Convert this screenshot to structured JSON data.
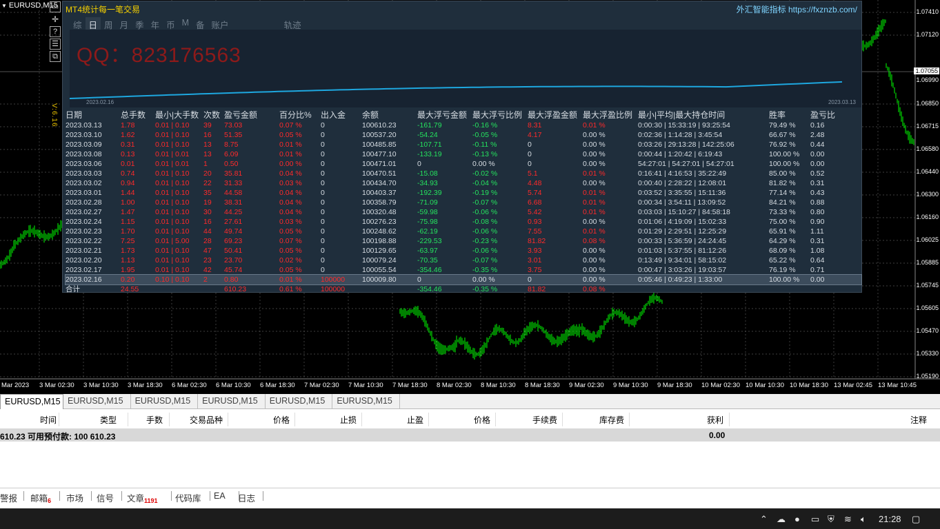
{
  "chart": {
    "symbol": "EURUSD,M15",
    "version_label": "V:6.16",
    "price_ticks": [
      "1.07410",
      "1.07120",
      "1.07055",
      "1.06990",
      "1.06850",
      "1.06715",
      "1.06580",
      "1.06440",
      "1.06300",
      "1.06160",
      "1.06025",
      "1.05885",
      "1.05745",
      "1.05605",
      "1.05470",
      "1.05330",
      "1.05190"
    ],
    "current_price": "1.07055",
    "time_ticks": [
      "Mar 2023",
      "3 Mar 02:30",
      "3 Mar 10:30",
      "3 Mar 18:30",
      "6 Mar 02:30",
      "6 Mar 10:30",
      "6 Mar 18:30",
      "7 Mar 02:30",
      "7 Mar 10:30",
      "7 Mar 18:30",
      "8 Mar 02:30",
      "8 Mar 10:30",
      "8 Mar 18:30",
      "9 Mar 02:30",
      "9 Mar 10:30",
      "9 Mar 18:30",
      "10 Mar 02:30",
      "10 Mar 10:30",
      "10 Mar 18:30",
      "13 Mar 02:45",
      "13 Mar 10:45"
    ],
    "candle_color": "#00ff00"
  },
  "left_icons": [
    "crosshair-icon",
    "help-icon",
    "indicator-list-icon",
    "templates-icon"
  ],
  "panel": {
    "title": "MT4统计每一笔交易",
    "brand": "外汇智能指标 https://fxznzb.com/",
    "tabs": [
      "综",
      "日",
      "周",
      "月",
      "季",
      "年",
      "币",
      "M",
      "备",
      "账户",
      "轨迹"
    ],
    "active_tab": "日",
    "watermark": "QQ：823176563",
    "curve_start": "2023.02.16",
    "curve_end": "2023.03.13",
    "curve_color": "#1ea8e0",
    "headers": [
      "日期",
      "总手数",
      "最小|大手数",
      "次数",
      "盈亏金额",
      "百分比%",
      "出入金",
      "余额",
      "最大浮亏金额",
      "最大浮亏比例",
      "最大浮盈金额",
      "最大浮盈比例",
      "最小|平均|最大持仓时间",
      "胜率",
      "盈亏比"
    ],
    "rows": [
      [
        "2023.03.13",
        "1.78",
        "0.01 | 0.10",
        "39",
        "73.03",
        "0.07 %",
        "0",
        "100610.23",
        "-161.79",
        "-0.16 %",
        "8.31",
        "0.01 %",
        "0:00:30 | 15:33:19 | 93:25:54",
        "79.49 %",
        "0.16"
      ],
      [
        "2023.03.10",
        "1.62",
        "0.01 | 0.10",
        "16",
        "51.35",
        "0.05 %",
        "0",
        "100537.20",
        "-54.24",
        "-0.05 %",
        "4.17",
        "0.00 %",
        "0:02:36 | 1:14:28 | 3:45:54",
        "66.67 %",
        "2.48"
      ],
      [
        "2023.03.09",
        "0.31",
        "0.01 | 0.10",
        "13",
        "8.75",
        "0.01 %",
        "0",
        "100485.85",
        "-107.71",
        "-0.11 %",
        "0",
        "0.00 %",
        "0:03:26 | 29:13:28 | 142:25:06",
        "76.92 %",
        "0.44"
      ],
      [
        "2023.03.08",
        "0.13",
        "0.01 | 0.01",
        "13",
        "6.09",
        "0.01 %",
        "0",
        "100477.10",
        "-133.19",
        "-0.13 %",
        "0",
        "0.00 %",
        "0:00:44 | 1:20:42 | 6:19:43",
        "100.00 %",
        "0.00"
      ],
      [
        "2023.03.06",
        "0.01",
        "0.01 | 0.01",
        "1",
        "0.50",
        "0.00 %",
        "0",
        "100471.01",
        "0",
        "0.00 %",
        "0",
        "0.00 %",
        "54:27:01 | 54:27:01 | 54:27:01",
        "100.00 %",
        "0.00"
      ],
      [
        "2023.03.03",
        "0.74",
        "0.01 | 0.10",
        "20",
        "35.81",
        "0.04 %",
        "0",
        "100470.51",
        "-15.08",
        "-0.02 %",
        "5.1",
        "0.01 %",
        "0:16:41 | 4:16:53 | 35:22:49",
        "85.00 %",
        "0.52"
      ],
      [
        "2023.03.02",
        "0.94",
        "0.01 | 0.10",
        "22",
        "31.33",
        "0.03 %",
        "0",
        "100434.70",
        "-34.93",
        "-0.04 %",
        "4.48",
        "0.00 %",
        "0:00:40 | 2:28:22 | 12:08:01",
        "81.82 %",
        "0.31"
      ],
      [
        "2023.03.01",
        "1.44",
        "0.01 | 0.10",
        "35",
        "44.58",
        "0.04 %",
        "0",
        "100403.37",
        "-192.39",
        "-0.19 %",
        "5.74",
        "0.01 %",
        "0:03:52 | 3:35:55 | 15:11:36",
        "77.14 %",
        "0.43"
      ],
      [
        "2023.02.28",
        "1.00",
        "0.01 | 0.10",
        "19",
        "38.31",
        "0.04 %",
        "0",
        "100358.79",
        "-71.09",
        "-0.07 %",
        "6.68",
        "0.01 %",
        "0:00:34 | 3:54:11 | 13:09:52",
        "84.21 %",
        "0.88"
      ],
      [
        "2023.02.27",
        "1.47",
        "0.01 | 0.10",
        "30",
        "44.25",
        "0.04 %",
        "0",
        "100320.48",
        "-59.98",
        "-0.06 %",
        "5.42",
        "0.01 %",
        "0:03:03 | 15:10:27 | 84:58:18",
        "73.33 %",
        "0.80"
      ],
      [
        "2023.02.24",
        "1.15",
        "0.01 | 0.10",
        "16",
        "27.61",
        "0.03 %",
        "0",
        "100276.23",
        "-75.98",
        "-0.08 %",
        "0.93",
        "0.00 %",
        "0:01:06 | 4:19:09 | 15:02:33",
        "75.00 %",
        "0.90"
      ],
      [
        "2023.02.23",
        "1.70",
        "0.01 | 0.10",
        "44",
        "49.74",
        "0.05 %",
        "0",
        "100248.62",
        "-62.19",
        "-0.06 %",
        "7.55",
        "0.01 %",
        "0:01:29 | 2:29:51 | 12:25:29",
        "65.91 %",
        "1.11"
      ],
      [
        "2023.02.22",
        "7.25",
        "0.01 | 5.00",
        "28",
        "69.23",
        "0.07 %",
        "0",
        "100198.88",
        "-229.53",
        "-0.23 %",
        "81.82",
        "0.08 %",
        "0:00:33 | 5:36:59 | 24:24:45",
        "64.29 %",
        "0.31"
      ],
      [
        "2023.02.21",
        "1.73",
        "0.01 | 0.10",
        "47",
        "50.41",
        "0.05 %",
        "0",
        "100129.65",
        "-63.97",
        "-0.06 %",
        "3.93",
        "0.00 %",
        "0:01:03 | 5:37:55 | 81:12:26",
        "68.09 %",
        "1.08"
      ],
      [
        "2023.02.20",
        "1.13",
        "0.01 | 0.10",
        "23",
        "23.70",
        "0.02 %",
        "0",
        "100079.24",
        "-70.35",
        "-0.07 %",
        "3.01",
        "0.00 %",
        "0:13:49 | 9:34:01 | 58:15:02",
        "65.22 %",
        "0.64"
      ],
      [
        "2023.02.17",
        "1.95",
        "0.01 | 0.10",
        "42",
        "45.74",
        "0.05 %",
        "0",
        "100055.54",
        "-354.46",
        "-0.35 %",
        "3.75",
        "0.00 %",
        "0:00:47 | 3:03:26 | 19:03:57",
        "76.19 %",
        "0.71"
      ],
      [
        "2023.02.16",
        "0.20",
        "0.10 | 0.10",
        "2",
        "0.80",
        "0.01 %",
        "100000",
        "100009.80",
        "0",
        "0.00 %",
        "0",
        "0.00 %",
        "0:05:46 | 0:49:23 | 1:33:00",
        "100.00 %",
        "0.00"
      ]
    ],
    "total": {
      "label": "合计",
      "lots": "24.55",
      "profit": "610.23",
      "pct": "0.61 %",
      "deposit": "100000",
      "max_loss": "-354.46",
      "max_loss_pct": "-0.35 %",
      "max_gain": "81.82",
      "max_gain_pct": "0.08 %"
    }
  },
  "chart_tabs": [
    "EURUSD,M15",
    "EURUSD,M15",
    "EURUSD,M15",
    "EURUSD,M15",
    "EURUSD,M15",
    "EURUSD,M15"
  ],
  "terminal": {
    "columns": [
      "时间",
      "类型",
      "手数",
      "交易品种",
      "价格",
      "止损",
      "止盈",
      "价格",
      "手续费",
      "库存费",
      "获利",
      "注释"
    ],
    "summary_text": "610.23  可用预付款: 100 610.23",
    "summary_profit": "0.00",
    "tabs": [
      {
        "label": "警报",
        "badge": ""
      },
      {
        "label": "邮箱",
        "badge": "6"
      },
      {
        "label": "市场",
        "badge": ""
      },
      {
        "label": "信号",
        "badge": ""
      },
      {
        "label": "文章",
        "badge": "1191"
      },
      {
        "label": "代码库",
        "badge": ""
      },
      {
        "label": "EA",
        "badge": ""
      },
      {
        "label": "日志",
        "badge": ""
      }
    ]
  },
  "taskbar": {
    "clock": "21:28"
  }
}
